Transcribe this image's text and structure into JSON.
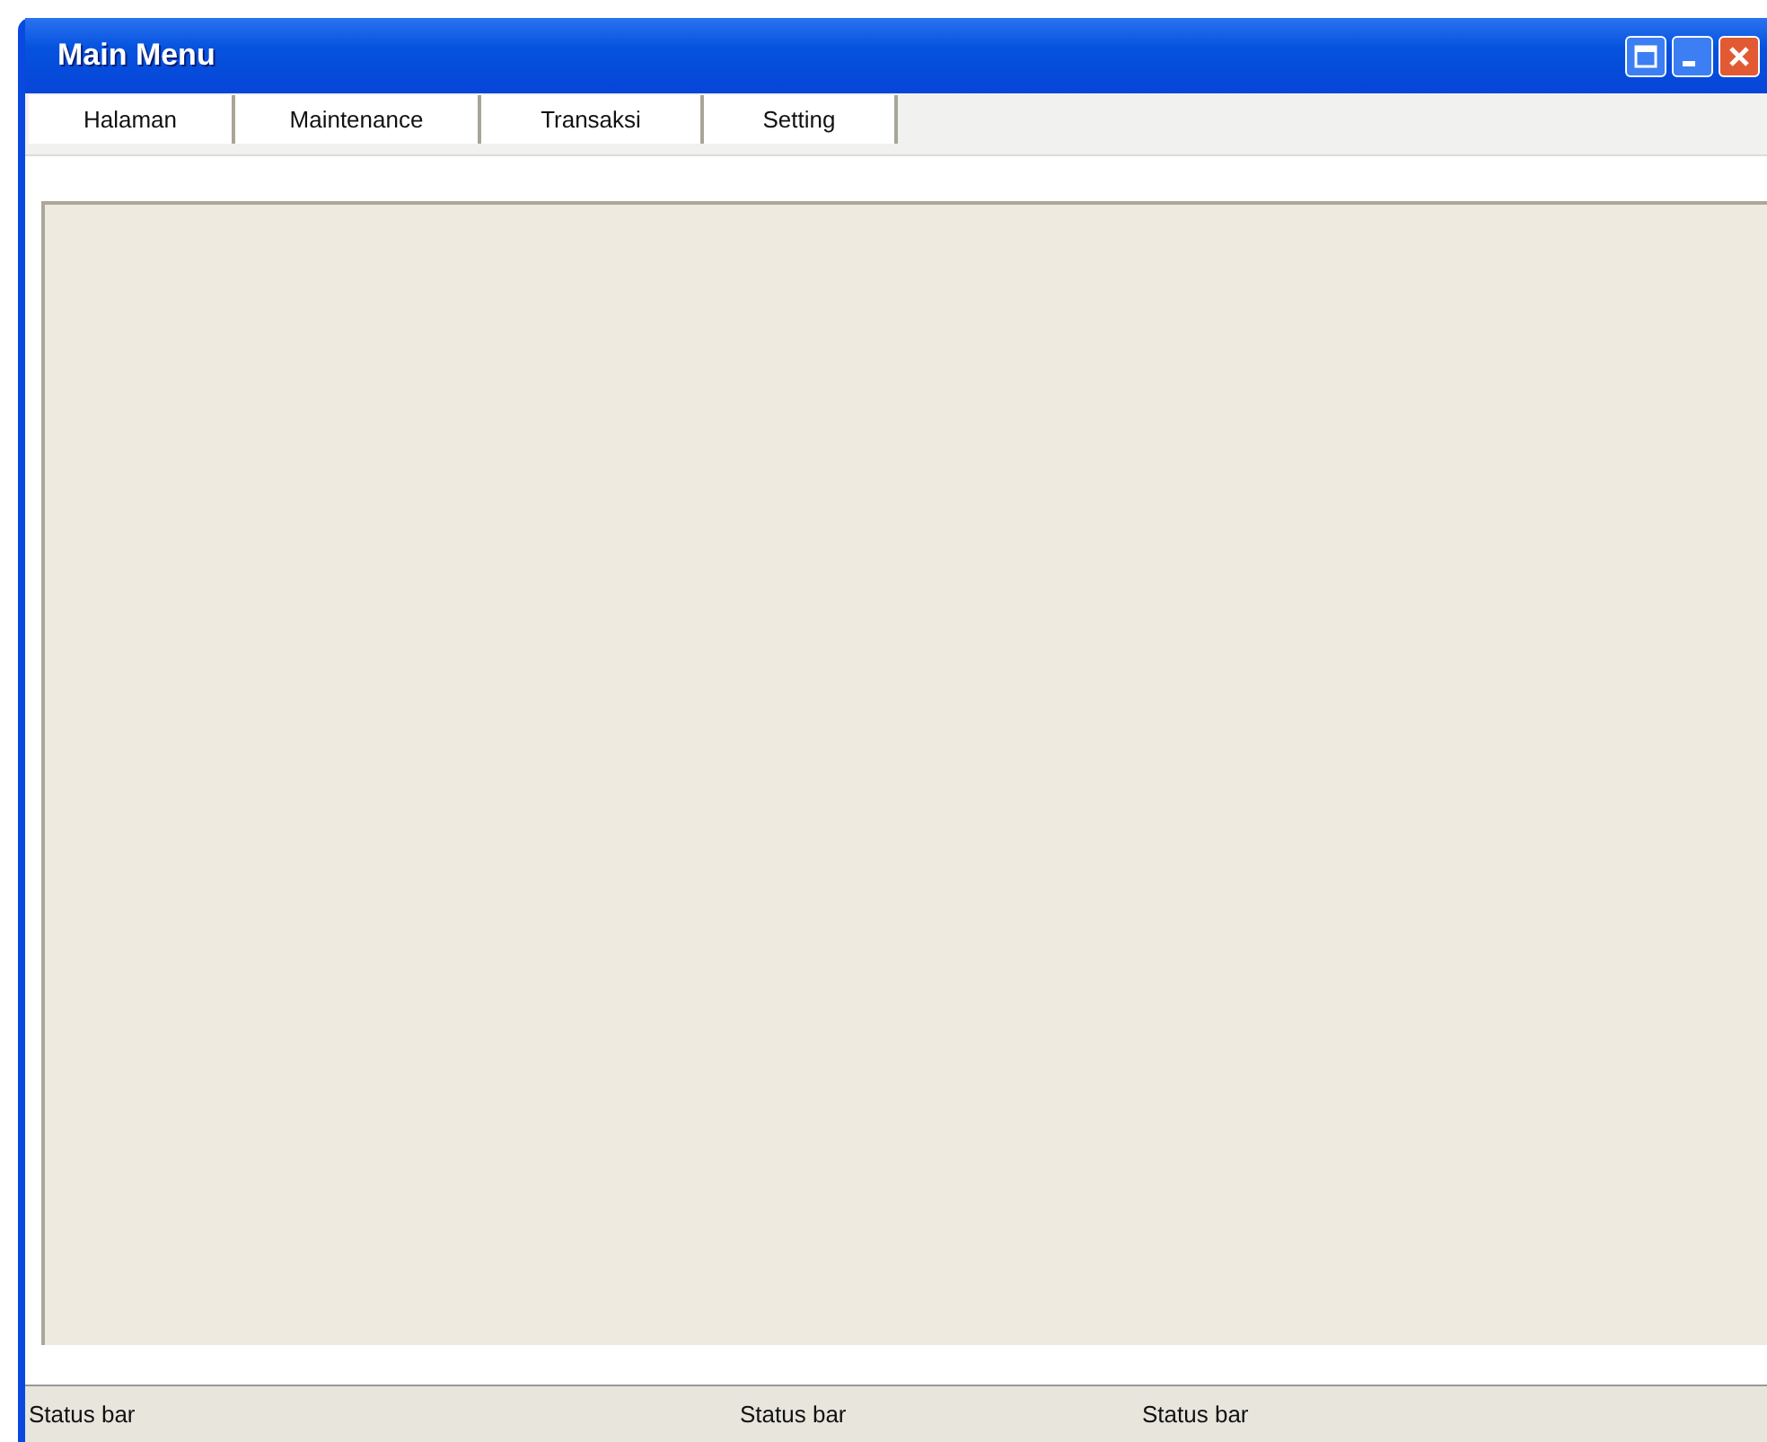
{
  "window": {
    "title": "Main Menu"
  },
  "menu": [
    {
      "label": "Halaman"
    },
    {
      "label": "Maintenance"
    },
    {
      "label": "Transaksi"
    },
    {
      "label": "Setting"
    }
  ],
  "status_bar": [
    "Status bar",
    "Status bar",
    "Status bar"
  ]
}
